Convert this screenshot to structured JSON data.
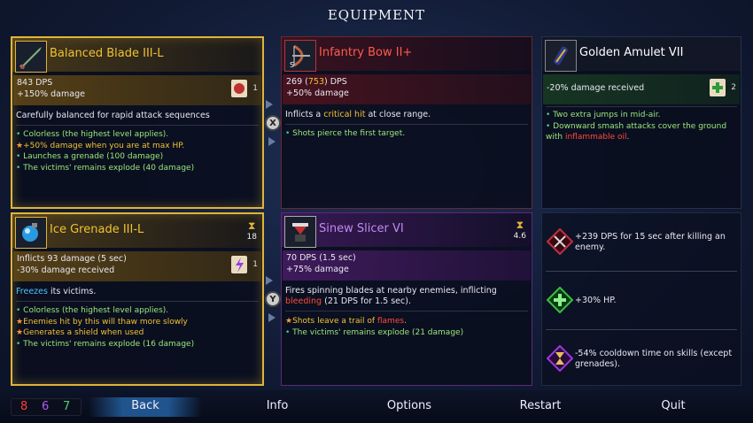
{
  "title": "EQUIPMENT",
  "cards": {
    "blade": {
      "name": "Balanced Blade III-L",
      "stat1": "843 DPS",
      "stat2": "+150% damage",
      "scroll_count": "1",
      "description": "Carefully balanced for rapid attack sequences",
      "affixes": [
        "Colorless (the highest level applies).",
        "+50% damage when you are at max HP.",
        "Launches a grenade (100 damage)",
        "The victims' remains explode (40 damage)"
      ],
      "color": "#e0b43a"
    },
    "bow": {
      "name": "Infantry Bow II+",
      "stat1_main": "269 (",
      "stat1_crit": "753",
      "stat1_end": ") DPS",
      "stat2": "+50% damage",
      "desc_pre": "Inflicts a ",
      "desc_hl": "critical hit",
      "desc_post": " at close range.",
      "affixes": [
        "Shots pierce the first target."
      ],
      "color": "#c0303a"
    },
    "amulet": {
      "name": "Golden Amulet VII",
      "stat": "-20% damage received",
      "scroll_count": "2",
      "affix1": "Two extra jumps in mid-air.",
      "affix2_pre": "Downward smash attacks cover the ground with ",
      "affix2_hl": "inflammable oil",
      "affix2_post": ".",
      "color": "#3a8a3a"
    },
    "grenade": {
      "name": "Ice Grenade III-L",
      "stat1": "Inflicts 93 damage (5 sec)",
      "stat2": "-30% damage received",
      "scroll_count": "1",
      "cooldown": "18",
      "desc_hl": "Freezes",
      "desc_post": " its victims.",
      "affixes": [
        "Colorless (the highest level applies).",
        "Enemies hit by this will thaw more slowly",
        "Generates a shield when used",
        "The victims' remains explode (16 damage)"
      ],
      "color": "#e0b43a"
    },
    "slicer": {
      "name": "Sinew Slicer VI",
      "stat1": "70 DPS (1.5 sec)",
      "stat2": "+75% damage",
      "cooldown": "4.6",
      "desc_pre": "Fires spinning blades at nearby enemies, inflicting ",
      "desc_hl": "bleeding",
      "desc_post": " (21 DPS for 1.5 sec).",
      "affix1_pre": "Shots leave a trail of ",
      "affix1_hl": "flames",
      "affix1_post": ".",
      "affix2": "The victims' remains explode (21 damage)",
      "color": "#8a3ac0"
    }
  },
  "swap_buttons": [
    "X",
    "Y"
  ],
  "mutations": [
    {
      "text": "+239 DPS for 15 sec after killing an enemy.",
      "icon": "crossbow-icon"
    },
    {
      "text": "+30% HP.",
      "icon": "green-cross-icon"
    },
    {
      "text": "-54% cooldown time on skills (except grenades).",
      "icon": "hourglass-icon"
    }
  ],
  "cells": {
    "red": "8",
    "purple": "6",
    "green": "7"
  },
  "nav": {
    "back": "Back",
    "info": "Info",
    "options": "Options",
    "restart": "Restart",
    "quit": "Quit"
  }
}
